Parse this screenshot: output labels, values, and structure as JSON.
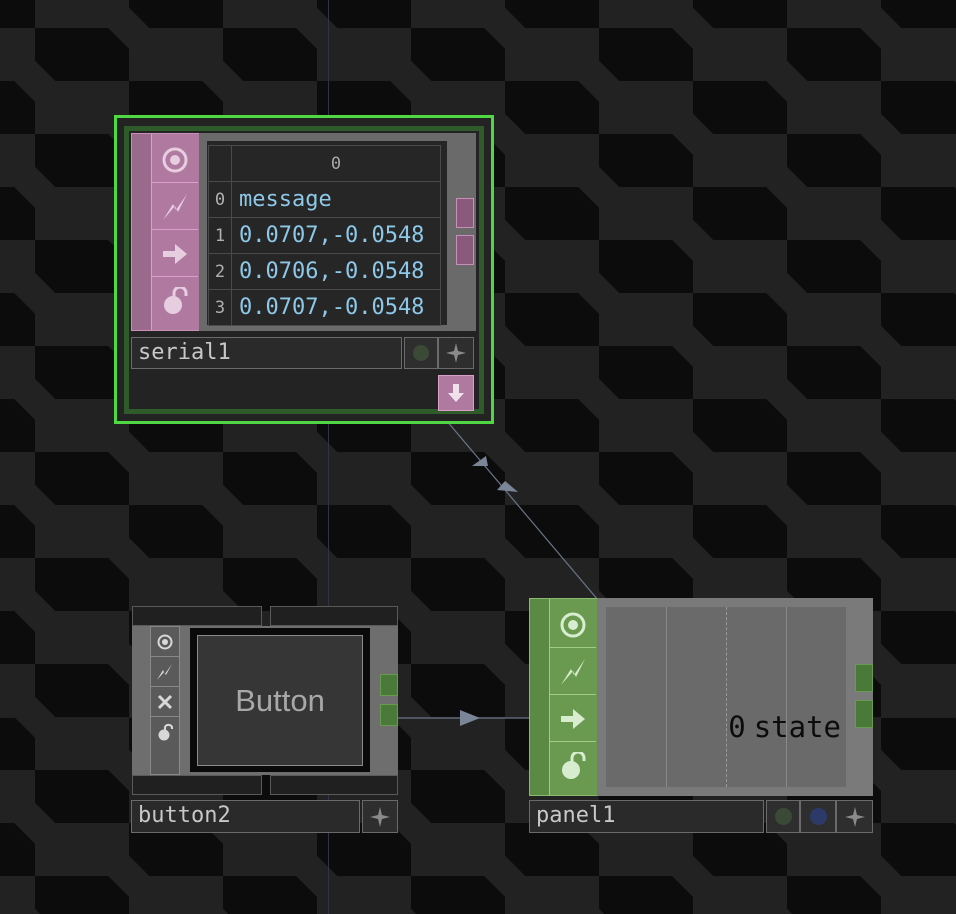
{
  "serial1": {
    "name": "serial1",
    "table": {
      "column_header": "0",
      "rows": [
        {
          "index": "0",
          "value": "message"
        },
        {
          "index": "1",
          "value": "0.0707,-0.0548"
        },
        {
          "index": "2",
          "value": "0.0706,-0.0548"
        },
        {
          "index": "3",
          "value": "0.0707,-0.0548"
        }
      ]
    }
  },
  "button2": {
    "name": "button2",
    "button_label": "Button"
  },
  "panel1": {
    "name": "panel1",
    "value": "0",
    "channel": "state"
  },
  "colors": {
    "selection_green": "#4fd843",
    "dat_pink": "#c890b8",
    "panel_green": "#6a9a50",
    "value_blue": "#8ec8e8"
  },
  "icons": {
    "viewer": "target-icon",
    "cook": "lightning-icon",
    "export": "arrow-right-icon",
    "lock": "lock-icon",
    "bypass": "x-icon",
    "flag": "sparkle-icon",
    "output": "arrow-down-icon"
  }
}
